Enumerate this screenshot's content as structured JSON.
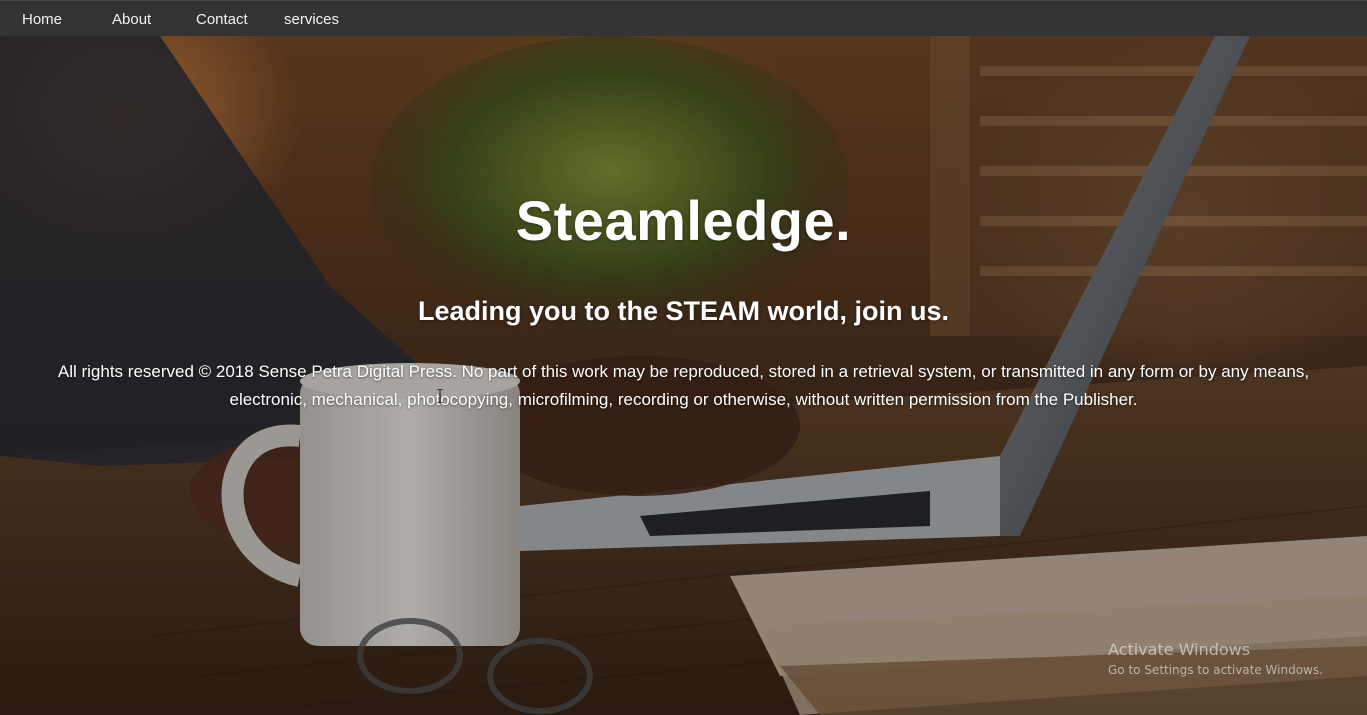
{
  "nav": {
    "items": [
      {
        "label": "Home"
      },
      {
        "label": "About"
      },
      {
        "label": "Contact"
      },
      {
        "label": "services"
      }
    ]
  },
  "hero": {
    "title": "Steamledge.",
    "subtitle": "Leading you to the STEAM world, join us.",
    "copyright": "All rights reserved © 2018 Sense Petra Digital Press. No part of this work may be reproduced, stored in a retrieval system, or transmitted in any form or by any means, electronic, mechanical, photocopying, microfilming, recording or otherwise, without written permission from the Publisher."
  },
  "watermark": {
    "title": "Activate Windows",
    "subtitle": "Go to Settings to activate Windows."
  },
  "colors": {
    "navbar_bg": "#333333",
    "nav_text": "#f2f2f2",
    "hero_text": "#ffffff"
  },
  "icons": {
    "cursor": "text-cursor-icon"
  }
}
